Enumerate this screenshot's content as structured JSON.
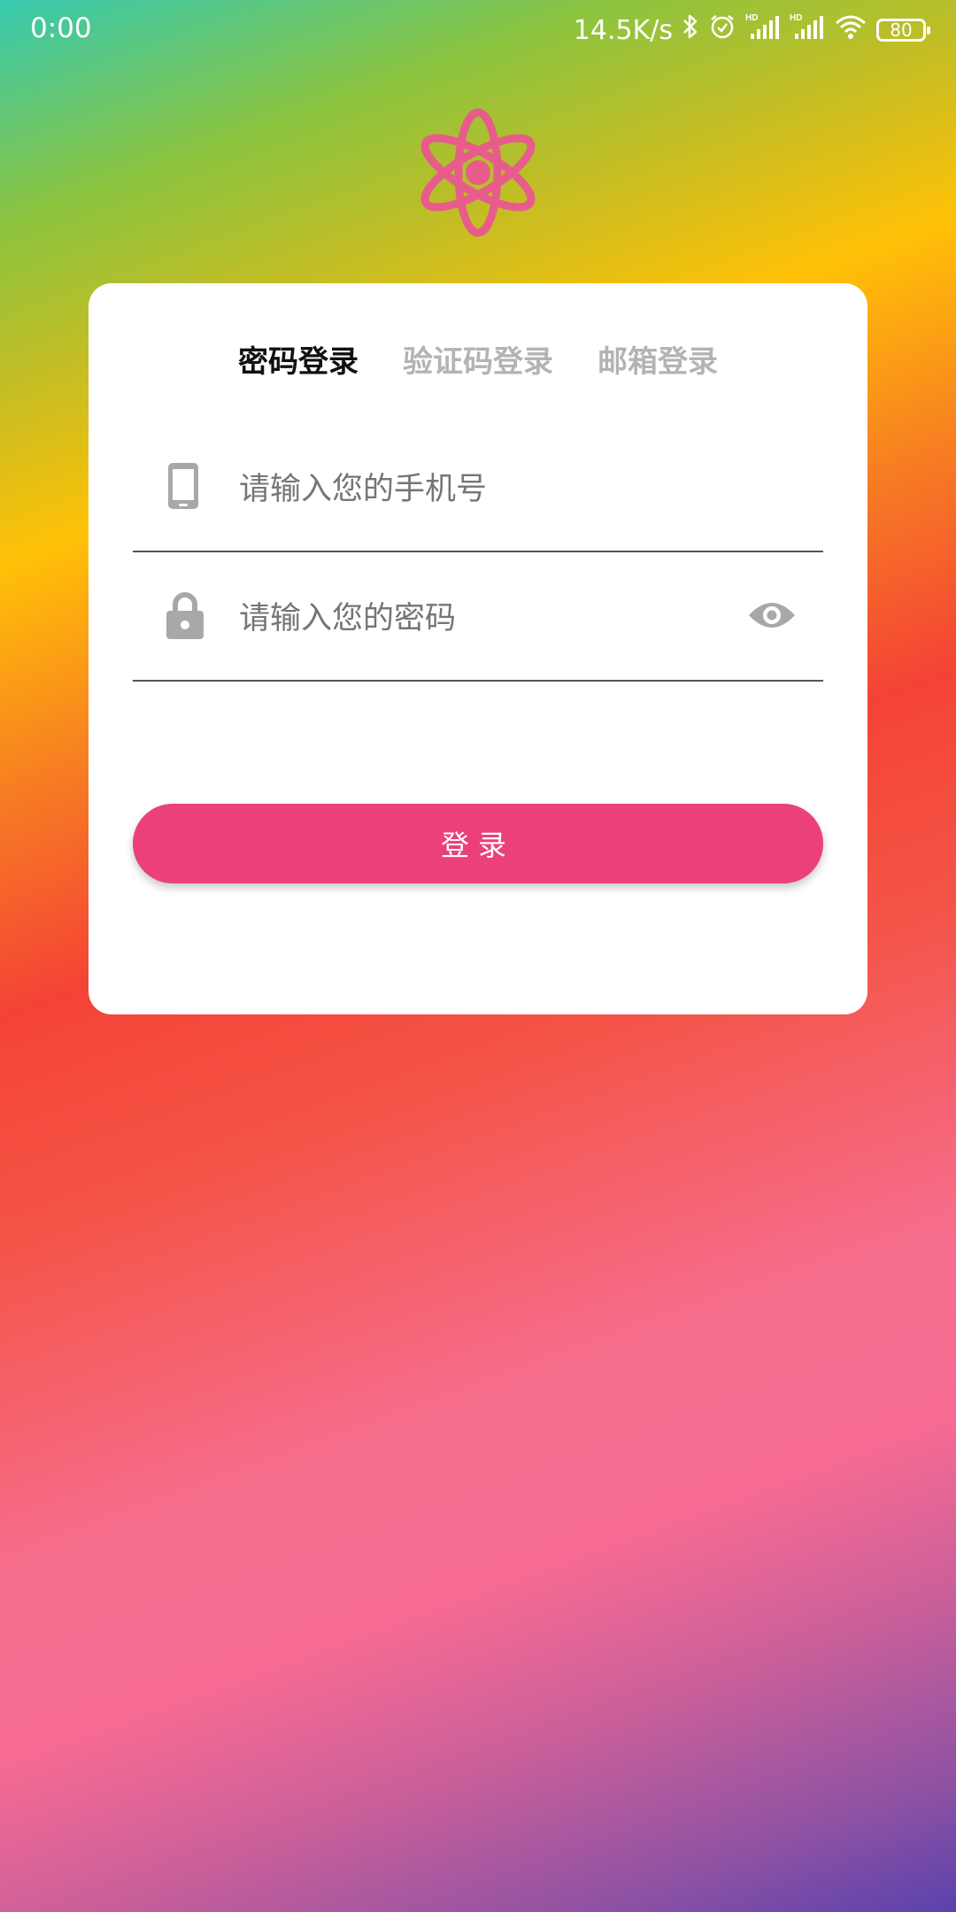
{
  "status_bar": {
    "time": "0:00",
    "network_speed": "14.5K/s",
    "battery_level": "80",
    "icons": [
      "bluetooth-icon",
      "alarm-icon",
      "signal-hd-icon",
      "signal-hd-icon",
      "wifi-icon",
      "battery-icon"
    ]
  },
  "logo": {
    "icon": "atom-icon",
    "color": "#e85c8c"
  },
  "tabs": [
    {
      "label": "密码登录",
      "active": true
    },
    {
      "label": "验证码登录",
      "active": false
    },
    {
      "label": "邮箱登录",
      "active": false
    }
  ],
  "form": {
    "phone": {
      "placeholder": "请输入您的手机号",
      "value": "",
      "icon": "phone-icon"
    },
    "password": {
      "placeholder": "请输入您的密码",
      "value": "",
      "icon": "lock-icon",
      "toggle_icon": "eye-icon"
    },
    "submit_label": "登录"
  },
  "colors": {
    "accent": "#eb407a",
    "active_tab": "#111111",
    "inactive_tab": "#b3b3b3",
    "icon_gray": "#a8a8a8"
  }
}
